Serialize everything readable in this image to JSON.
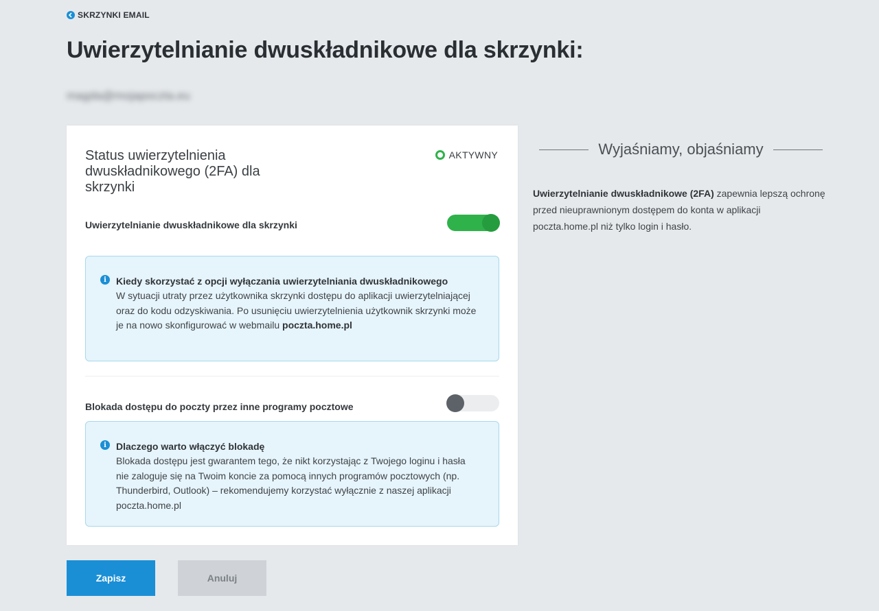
{
  "nav": {
    "back_label": "SKRZYNKI EMAIL"
  },
  "page": {
    "title": "Uwierzytelnianie dwuskładnikowe dla skrzynki:",
    "mailbox": "magda@mojapoczta.eu"
  },
  "card": {
    "status_title": "Status uwierzytelnienia dwuskładnikowego (2FA) dla skrzynki",
    "status_badge": "AKTYWNY",
    "twofa_label": "Uwierzytelnianie dwuskładnikowe dla skrzynki",
    "twofa_enabled": true,
    "info1": {
      "heading": "Kiedy skorzystać z opcji wyłączania uwierzytelniania dwuskładnikowego",
      "body": "W sytuacji utraty przez użytkownika skrzynki dostępu do aplikacji uwierzytelniającej oraz do kodu odzyskiwania. Po usunięciu uwierzytelnienia użytkownik skrzynki może je na nowo skonfigurować w webmailu",
      "body_link": "poczta.home.pl"
    },
    "block_label": "Blokada dostępu do poczty przez inne programy pocztowe",
    "block_enabled": false,
    "info2": {
      "heading": "Dlaczego warto włączyć blokadę",
      "body": "Blokada dostępu jest gwarantem tego, że nikt korzystając z Twojego loginu i hasła nie zaloguje się na Twoim koncie za pomocą innych programów pocztowych (np. Thunderbird, Outlook) – rekomendujemy korzystać wyłącznie z naszej aplikacji poczta.home.pl"
    }
  },
  "side": {
    "heading": "Wyjaśniamy, objaśniamy",
    "text_bold": "Uwierzytelnianie dwuskładnikowe (2FA)",
    "text_rest": " zapewnia lepszą ochronę przed nieuprawnionym dostępem do konta w aplikacji poczta.home.pl niż tylko login i hasło."
  },
  "buttons": {
    "save": "Zapisz",
    "cancel": "Anuluj"
  },
  "colors": {
    "accent": "#1a8fd6",
    "active": "#2fb24a",
    "info_bg": "#e6f4fb",
    "page_bg": "#e6e9ec"
  },
  "icons": {
    "back": "arrow-left-circle-icon",
    "status": "status-circle-icon",
    "info": "info-icon"
  }
}
